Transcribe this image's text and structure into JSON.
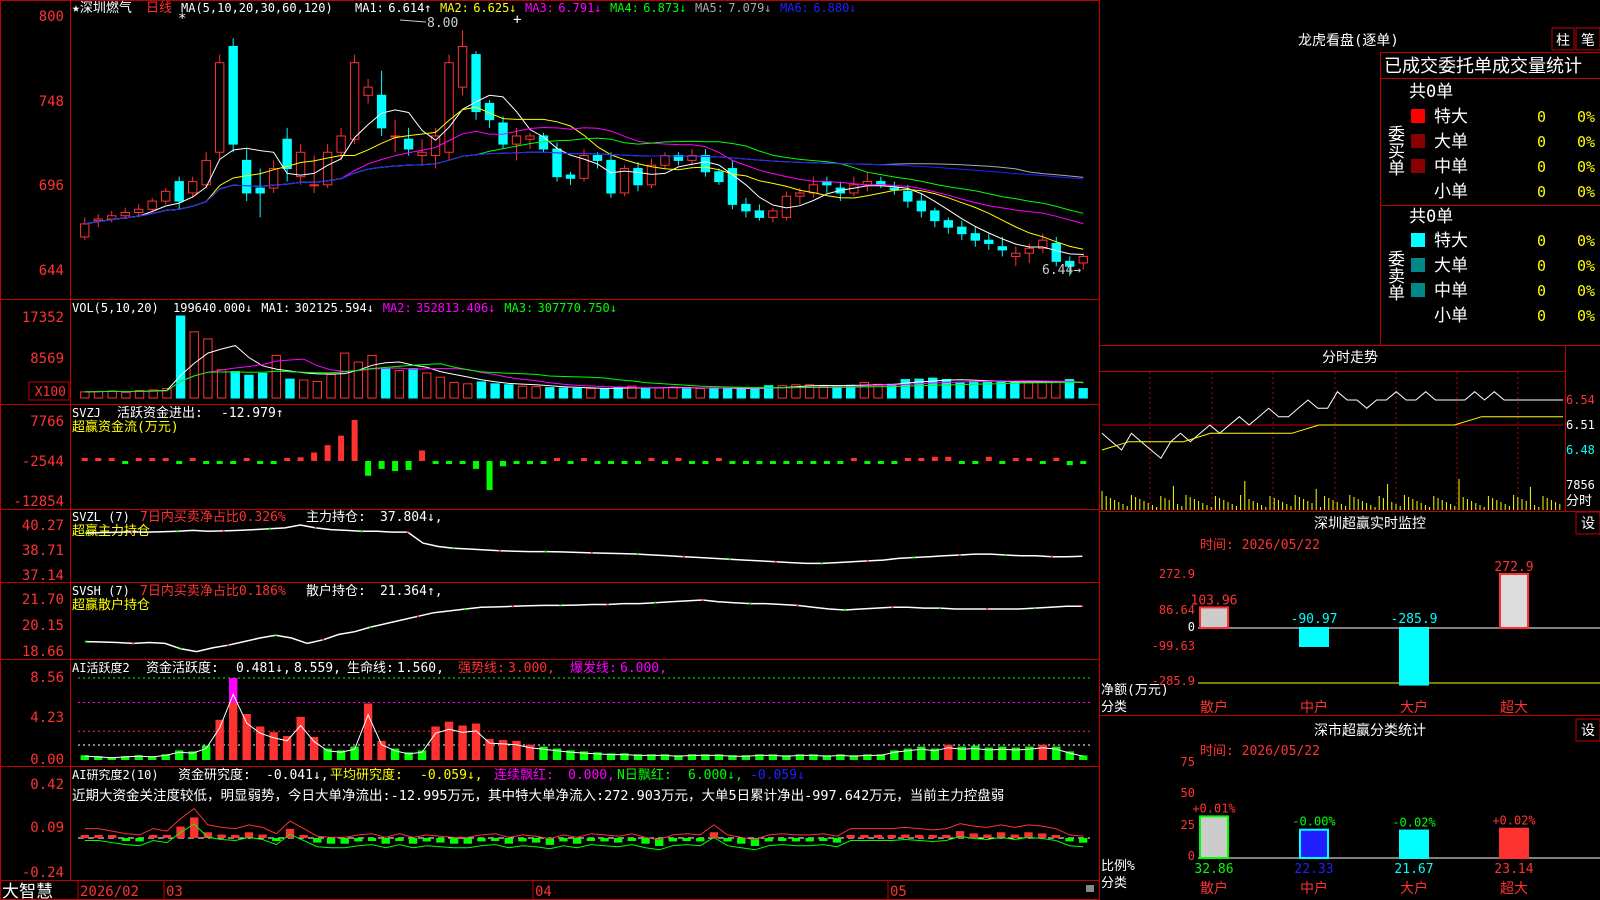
{
  "colors": {
    "up": "#ff3232",
    "down": "#00ffff",
    "grid": "#c00000",
    "white": "#ffffff",
    "yellow": "#ffff00",
    "magenta": "#ff00ff",
    "green": "#00ff00",
    "blue": "#2020ff",
    "gray": "#aaaaaa"
  },
  "main": {
    "title": "★深圳燃气",
    "period": "日线",
    "ma_params": "MA(5,10,20,30,60,120)",
    "ma_values": [
      {
        "label": "MA1:",
        "value": "6.614↑",
        "color": "#ffffff"
      },
      {
        "label": "MA2:",
        "value": "6.625↓",
        "color": "#ffff00"
      },
      {
        "label": "MA3:",
        "value": "6.791↓",
        "color": "#ff00ff"
      },
      {
        "label": "MA4:",
        "value": "6.873↓",
        "color": "#00ff00"
      },
      {
        "label": "MA5:",
        "value": "7.079↓",
        "color": "#aaaaaa"
      },
      {
        "label": "MA6:",
        "value": "6.880↓",
        "color": "#2020ff"
      }
    ],
    "y_ticks": [
      "800",
      "748",
      "696",
      "644"
    ],
    "high_label": "8.00",
    "low_label": "6.44→",
    "star_marks": [
      "*",
      "+"
    ]
  },
  "vol": {
    "title": "VOL(5,10,20)",
    "values": [
      {
        "label": "",
        "value": "199640.000↓",
        "color": "#ffffff"
      },
      {
        "label": "MA1:",
        "value": "302125.594↓",
        "color": "#ffffff"
      },
      {
        "label": "MA2:",
        "value": "352813.406↓",
        "color": "#ff00ff"
      },
      {
        "label": "MA3:",
        "value": "307770.750↓",
        "color": "#00ff00"
      }
    ],
    "y_ticks": [
      "17352",
      "8569"
    ],
    "unit": "X100"
  },
  "svzj": {
    "title": "SVZJ",
    "label1": "活跃资金进出:",
    "value1": "-12.979↑",
    "subtitle": "超赢资金流(万元)",
    "y_ticks": [
      "7766",
      "-2544",
      "-12854"
    ]
  },
  "svzl": {
    "title": "SVZL (7)",
    "pct_text": "7日内买卖净占比0.326%",
    "label": "主力持仓:",
    "value": "37.804↓,",
    "subtitle": "超赢主力持仓",
    "y_ticks": [
      "40.27",
      "38.71",
      "37.14"
    ]
  },
  "svsh": {
    "title": "SVSH (7)",
    "pct_text": "7日内买卖净占比0.186%",
    "label": "散户持仓:",
    "value": "21.364↑,",
    "subtitle": "超赢散户持仓",
    "y_ticks": [
      "21.70",
      "20.15",
      "18.66"
    ]
  },
  "ai1": {
    "title": "AI活跃度2",
    "label1": "资金活跃度:",
    "value1": "0.481↓,",
    "value2": "8.559,",
    "label3": "生命线:",
    "value3": "1.560,",
    "label4": "强势线:",
    "value4": "3.000,",
    "label5": "爆发线:",
    "value5": "6.000,",
    "y_ticks": [
      "8.56",
      "4.23",
      "0.00"
    ]
  },
  "ai2": {
    "title": "AI研究度2(10)",
    "label1": "资金研究度:",
    "value1": "-0.041↓,",
    "label2": "平均研究度:",
    "value2": "-0.059↓,",
    "label3": "连续飘红:",
    "value3": "0.000,",
    "label4": "N日飘红:",
    "value4": "6.000↓,",
    "value5": "-0.059↓",
    "comment": "近期大资金关注度较低，明显弱势，今日大单净流出:-12.995万元，其中特大单净流入:272.903万元，大单5日累计净出-997.642万元，当前主力控盘弱",
    "y_ticks": [
      "0.42",
      "0.09",
      "-0.24"
    ]
  },
  "xaxis": {
    "brand": "大智慧",
    "labels": [
      "2026/02",
      "03",
      "04",
      "05"
    ]
  },
  "right": {
    "dragon_title": "龙虎看盘(逐单)",
    "btn1": "柱",
    "btn2": "笔",
    "stats_title": "已成交委托单成交量统计",
    "buy_side": "委买单",
    "sell_side": "委卖单",
    "buy_total": "共0单",
    "sell_total": "共0单",
    "rows": [
      {
        "name": "特大",
        "count": "0",
        "pct": "0%"
      },
      {
        "name": "大单",
        "count": "0",
        "pct": "0%"
      },
      {
        "name": "中单",
        "count": "0",
        "pct": "0%"
      },
      {
        "name": "小单",
        "count": "0",
        "pct": "0%"
      }
    ],
    "intraday_title": "分时走势",
    "intraday_ticks": [
      "6.54",
      "6.51",
      "6.48"
    ],
    "intraday_vol": "7856",
    "intraday_foot": "分时",
    "monitor_title": "深圳超赢实时监控",
    "monitor_set": "设",
    "monitor_time": "时间: 2026/05/22",
    "monitor_ticks": [
      "272.9",
      "86.64",
      "0",
      "-99.63",
      "-285.9"
    ],
    "monitor_unit": "净额(万元)",
    "monitor_cat": "分类",
    "class_title": "深市超赢分类统计",
    "class_set": "设",
    "class_time": "时间: 2026/05/22",
    "class_ticks": [
      "75",
      "50",
      "25",
      "0"
    ],
    "class_unit": "比例%",
    "class_cat": "分类"
  },
  "chart_data": [
    {
      "type": "candlestick",
      "title": "深圳燃气 日线",
      "ylim": [
        6.3,
        8.05
      ],
      "ohlc": [
        [
          6.68,
          6.8,
          6.66,
          6.76
        ],
        [
          6.78,
          6.82,
          6.74,
          6.79
        ],
        [
          6.79,
          6.84,
          6.77,
          6.81
        ],
        [
          6.81,
          6.86,
          6.79,
          6.83
        ],
        [
          6.83,
          6.88,
          6.8,
          6.85
        ],
        [
          6.85,
          6.92,
          6.83,
          6.9
        ],
        [
          6.9,
          6.98,
          6.88,
          6.96
        ],
        [
          7.02,
          7.05,
          6.85,
          6.9
        ],
        [
          6.95,
          7.05,
          6.92,
          7.02
        ],
        [
          7.0,
          7.2,
          6.98,
          7.15
        ],
        [
          7.2,
          7.8,
          7.15,
          7.75
        ],
        [
          7.85,
          7.9,
          7.2,
          7.25
        ],
        [
          7.15,
          7.22,
          6.9,
          6.95
        ],
        [
          6.98,
          7.1,
          6.8,
          6.95
        ],
        [
          6.98,
          7.15,
          6.95,
          7.1
        ],
        [
          7.28,
          7.35,
          7.02,
          7.1
        ],
        [
          7.05,
          7.25,
          7.0,
          7.2
        ],
        [
          7.0,
          7.18,
          6.95,
          7.0
        ],
        [
          7.0,
          7.25,
          6.98,
          7.2
        ],
        [
          7.2,
          7.35,
          7.15,
          7.3
        ],
        [
          7.28,
          7.8,
          7.25,
          7.75
        ],
        [
          7.55,
          7.65,
          7.5,
          7.6
        ],
        [
          7.55,
          7.7,
          7.3,
          7.35
        ],
        [
          7.3,
          7.4,
          7.2,
          7.3
        ],
        [
          7.28,
          7.35,
          7.18,
          7.22
        ],
        [
          7.18,
          7.28,
          7.12,
          7.2
        ],
        [
          7.18,
          7.35,
          7.1,
          7.3
        ],
        [
          7.2,
          7.8,
          7.15,
          7.75
        ],
        [
          7.6,
          7.95,
          7.55,
          7.85
        ],
        [
          7.8,
          7.82,
          7.4,
          7.45
        ],
        [
          7.5,
          7.52,
          7.35,
          7.4
        ],
        [
          7.38,
          7.42,
          7.22,
          7.25
        ],
        [
          7.25,
          7.35,
          7.15,
          7.3
        ],
        [
          7.28,
          7.32,
          7.22,
          7.3
        ],
        [
          7.3,
          7.32,
          7.2,
          7.22
        ],
        [
          7.22,
          7.26,
          7.02,
          7.05
        ],
        [
          7.06,
          7.08,
          7.0,
          7.04
        ],
        [
          7.04,
          7.22,
          7.02,
          7.18
        ],
        [
          7.18,
          7.2,
          7.1,
          7.15
        ],
        [
          7.15,
          7.2,
          6.92,
          6.95
        ],
        [
          6.95,
          7.12,
          6.93,
          7.1
        ],
        [
          7.1,
          7.14,
          6.96,
          7.0
        ],
        [
          7.0,
          7.16,
          6.98,
          7.12
        ],
        [
          7.12,
          7.2,
          7.1,
          7.18
        ],
        [
          7.18,
          7.2,
          7.12,
          7.15
        ],
        [
          7.15,
          7.22,
          7.12,
          7.18
        ],
        [
          7.18,
          7.22,
          7.05,
          7.08
        ],
        [
          7.08,
          7.1,
          7.0,
          7.02
        ],
        [
          7.1,
          7.15,
          6.85,
          6.88
        ],
        [
          6.88,
          6.92,
          6.8,
          6.84
        ],
        [
          6.84,
          6.88,
          6.78,
          6.8
        ],
        [
          6.8,
          6.86,
          6.77,
          6.84
        ],
        [
          6.8,
          6.96,
          6.78,
          6.93
        ],
        [
          6.93,
          6.98,
          6.88,
          6.95
        ],
        [
          6.95,
          7.05,
          6.92,
          7.0
        ],
        [
          7.02,
          7.05,
          6.95,
          7.0
        ],
        [
          6.98,
          7.02,
          6.9,
          6.95
        ],
        [
          6.95,
          7.05,
          6.93,
          7.0
        ],
        [
          7.0,
          7.08,
          6.96,
          7.02
        ],
        [
          7.02,
          7.05,
          6.98,
          7.0
        ],
        [
          6.98,
          7.02,
          6.94,
          6.97
        ],
        [
          6.96,
          7.0,
          6.86,
          6.9
        ],
        [
          6.9,
          6.95,
          6.8,
          6.84
        ],
        [
          6.84,
          6.86,
          6.74,
          6.78
        ],
        [
          6.78,
          6.8,
          6.7,
          6.74
        ],
        [
          6.74,
          6.78,
          6.66,
          6.7
        ],
        [
          6.7,
          6.74,
          6.62,
          6.66
        ],
        [
          6.66,
          6.7,
          6.6,
          6.64
        ],
        [
          6.62,
          6.68,
          6.56,
          6.6
        ],
        [
          6.56,
          6.62,
          6.5,
          6.58
        ],
        [
          6.58,
          6.64,
          6.52,
          6.61
        ],
        [
          6.61,
          6.7,
          6.58,
          6.66
        ],
        [
          6.64,
          6.68,
          6.5,
          6.53
        ],
        [
          6.53,
          6.56,
          6.44,
          6.5
        ],
        [
          6.52,
          6.58,
          6.48,
          6.56
        ]
      ]
    },
    {
      "type": "bar",
      "title": "VOL(5,10,20)",
      "unit": "X100",
      "values": [
        1300,
        1400,
        1500,
        1200,
        1600,
        1700,
        2000,
        17352,
        14000,
        12500,
        6000,
        5600,
        4800,
        5200,
        9000,
        4000,
        3800,
        3500,
        5000,
        9500,
        7600,
        9000,
        6200,
        5800,
        6200,
        5300,
        4400,
        3300,
        3000,
        3400,
        3000,
        2800,
        2500,
        2400,
        2200,
        2100,
        2000,
        2000,
        1900,
        2300,
        2500,
        2000,
        2100,
        2300,
        2200,
        2000,
        2100,
        1900,
        1900,
        2000,
        2600,
        2600,
        2800,
        2800,
        2500,
        2400,
        2700,
        3300,
        2900,
        2900,
        3900,
        4000,
        4200,
        3900,
        3300,
        3500,
        3300,
        3600,
        3400,
        3200,
        3500,
        3500,
        3900,
        1996
      ]
    },
    {
      "type": "bar",
      "title": "超赢资金流(万元)",
      "values": [
        0,
        0,
        50,
        -100,
        80,
        60,
        50,
        -200,
        300,
        -400,
        -300,
        -200,
        300,
        -250,
        -200,
        280,
        700,
        1600,
        3000,
        4800,
        7766,
        -2800,
        -1500,
        -1900,
        -1700,
        2000,
        -200,
        -350,
        -100,
        -1500,
        -5500,
        -1000,
        -300,
        -600,
        -300,
        500,
        -400,
        200,
        -300,
        -200,
        -200,
        -300,
        100,
        -250,
        600,
        -350,
        -150,
        500,
        -400,
        -300,
        -600,
        -500,
        -200,
        -300,
        -400,
        -200,
        -100,
        200,
        -300,
        -100,
        -50,
        300,
        500,
        800,
        800,
        -200,
        -500,
        800,
        -400,
        500,
        400,
        -400,
        600,
        -800,
        -300
      ]
    },
    {
      "type": "line",
      "title": "超赢主力持仓",
      "ylim": [
        37.14,
        40.27
      ],
      "values": [
        39.8,
        39.82,
        39.84,
        39.86,
        39.85,
        39.87,
        39.9,
        39.95,
        39.9,
        39.92,
        39.95,
        40.0,
        40.05,
        40.1,
        40.27,
        40.1,
        40.0,
        39.95,
        39.9,
        39.9,
        39.85,
        39.85,
        39.2,
        39.0,
        38.9,
        38.85,
        38.8,
        38.75,
        38.72,
        38.7,
        38.7,
        38.68,
        38.65,
        38.62,
        38.6,
        38.58,
        38.55,
        38.5,
        38.45,
        38.4,
        38.35,
        38.3,
        38.25,
        38.2,
        38.15,
        38.1,
        38.05,
        38.0,
        38.0,
        38.05,
        38.1,
        38.15,
        38.2,
        38.3,
        38.35,
        38.4,
        38.45,
        38.5,
        38.55,
        38.55,
        38.5,
        38.45,
        38.45,
        38.4,
        38.4,
        38.42
      ]
    },
    {
      "type": "line",
      "title": "超赢散户持仓",
      "ylim": [
        18.66,
        21.7
      ],
      "values": [
        19.4,
        19.38,
        19.35,
        19.3,
        19.35,
        19.3,
        19.0,
        18.85,
        19.05,
        19.2,
        19.4,
        19.6,
        19.75,
        19.6,
        19.3,
        19.5,
        19.8,
        19.95,
        20.2,
        20.4,
        20.6,
        20.8,
        21.0,
        21.1,
        21.2,
        21.3,
        21.32,
        21.35,
        21.38,
        21.4,
        21.4,
        21.42,
        21.45,
        21.45,
        21.5,
        21.5,
        21.55,
        21.6,
        21.65,
        21.7,
        21.6,
        21.55,
        21.5,
        21.5,
        21.45,
        21.4,
        21.3,
        21.2,
        21.15,
        21.2,
        21.25,
        21.3,
        21.3,
        21.25,
        21.25,
        21.2,
        21.2,
        21.2,
        21.2,
        21.2,
        21.25,
        21.3,
        21.35,
        21.36
      ]
    },
    {
      "type": "bar",
      "title": "AI活跃度2",
      "ylim": [
        0,
        8.56
      ],
      "values": [
        0.5,
        0.4,
        0.3,
        0.4,
        0.5,
        0.4,
        0.6,
        1.0,
        0.9,
        1.5,
        4.2,
        8.56,
        4.8,
        3.5,
        2.9,
        2.5,
        4.5,
        2.4,
        1.2,
        1.0,
        1.4,
        5.9,
        2.0,
        1.2,
        0.8,
        1.0,
        3.5,
        4.0,
        3.6,
        3.8,
        2.2,
        2.1,
        2.0,
        1.6,
        1.4,
        1.2,
        1.0,
        0.9,
        0.8,
        0.7,
        0.7,
        0.6,
        0.6,
        0.6,
        0.5,
        0.6,
        0.6,
        0.6,
        0.5,
        0.5,
        0.6,
        0.6,
        0.5,
        0.6,
        0.6,
        0.5,
        0.6,
        0.5,
        0.6,
        0.6,
        1.0,
        1.2,
        1.4,
        1.2,
        1.6,
        1.4,
        1.5,
        1.3,
        1.4,
        1.3,
        1.4,
        1.6,
        1.4,
        0.9,
        0.481
      ],
      "lines": {
        "生命线": 1.56,
        "强势线": 3.0,
        "爆发线": 6.0
      }
    },
    {
      "type": "bar",
      "title": "AI研究度2(10)",
      "ylim": [
        -0.24,
        0.42
      ],
      "values": [
        0.02,
        0.02,
        0.0,
        -0.02,
        -0.03,
        0.02,
        0.0,
        0.1,
        0.18,
        0.05,
        0.03,
        0.02,
        0.05,
        0.03,
        -0.02,
        0.08,
        0.02,
        -0.04,
        -0.05,
        -0.05,
        -0.03,
        -0.02,
        -0.05,
        -0.02,
        -0.05,
        -0.03,
        -0.04,
        -0.05,
        -0.05,
        -0.03,
        -0.02,
        -0.05,
        -0.03,
        -0.04,
        -0.06,
        -0.03,
        -0.05,
        -0.02,
        -0.03,
        -0.04,
        -0.02,
        -0.05,
        -0.07,
        -0.03,
        -0.02,
        -0.03,
        0.05,
        -0.03,
        -0.05,
        -0.07,
        -0.03,
        -0.02,
        -0.03,
        -0.03,
        -0.02,
        -0.04,
        0.02,
        0.02,
        0.02,
        0.02,
        0.03,
        0.02,
        0.01,
        0.02,
        0.06,
        0.04,
        0.03,
        0.05,
        0.03,
        0.05,
        0.04,
        0.02,
        -0.03,
        -0.041
      ],
      "avg_line": -0.059
    },
    {
      "type": "line",
      "title": "分时走势",
      "ylim": [
        6.45,
        6.56
      ],
      "values": [
        6.5,
        6.49,
        6.48,
        6.5,
        6.49,
        6.48,
        6.47,
        6.49,
        6.5,
        6.49,
        6.5,
        6.51,
        6.5,
        6.51,
        6.52,
        6.51,
        6.52,
        6.53,
        6.52,
        6.52,
        6.53,
        6.54,
        6.53,
        6.53,
        6.55,
        6.54,
        6.54,
        6.53,
        6.54,
        6.54,
        6.55,
        6.54,
        6.54,
        6.55,
        6.54,
        6.54,
        6.54,
        6.54,
        6.55,
        6.54,
        6.55,
        6.54,
        6.54,
        6.54,
        6.54,
        6.54,
        6.54,
        6.54
      ],
      "avg_line": [
        6.48,
        6.49,
        6.49,
        6.49,
        6.5,
        6.5,
        6.5,
        6.5,
        6.51,
        6.51,
        6.51,
        6.51,
        6.51,
        6.51,
        6.52,
        6.52,
        6.52,
        6.52
      ]
    },
    {
      "type": "bar",
      "title": "深圳超赢实时监控",
      "categories": [
        "散户",
        "中户",
        "大户",
        "超大"
      ],
      "values": [
        103.96,
        -90.97,
        -285.9,
        272.9
      ],
      "ylim": [
        -285.9,
        272.9
      ]
    },
    {
      "type": "bar",
      "title": "深市超赢分类统计",
      "categories": [
        "散户",
        "中户",
        "大户",
        "超大"
      ],
      "values": [
        32.86,
        22.33,
        21.67,
        23.14
      ],
      "changes": [
        "+0.01%",
        "-0.00%",
        "-0.02%",
        "+0.02%"
      ],
      "ylim": [
        0,
        75
      ]
    }
  ]
}
